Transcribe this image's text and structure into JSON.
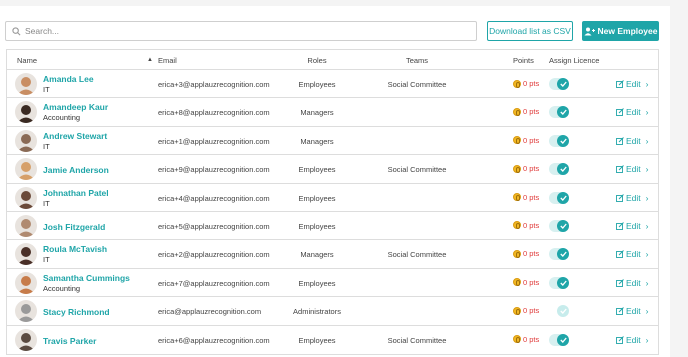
{
  "search": {
    "placeholder": "Search..."
  },
  "toolbar": {
    "download_label": "Download list as CSV",
    "new_employee_label": "New Employee"
  },
  "table": {
    "headers": {
      "name": "Name",
      "email": "Email",
      "roles": "Roles",
      "teams": "Teams",
      "points": "Points",
      "assign_licence": "Assign Licence"
    },
    "edit_label": "Edit",
    "rows": [
      {
        "name": "Amanda Lee",
        "dept": "IT",
        "email": "erica+3@applauzrecognition.com",
        "role": "Employees",
        "team": "Social Committee",
        "points": "0 pts",
        "licence": true
      },
      {
        "name": "Amandeep Kaur",
        "dept": "Accounting",
        "email": "erica+8@applauzrecognition.com",
        "role": "Managers",
        "team": "",
        "points": "0 pts",
        "licence": true
      },
      {
        "name": "Andrew Stewart",
        "dept": "IT",
        "email": "erica+1@applauzrecognition.com",
        "role": "Managers",
        "team": "",
        "points": "0 pts",
        "licence": true
      },
      {
        "name": "Jamie Anderson",
        "dept": "",
        "email": "erica+9@applauzrecognition.com",
        "role": "Employees",
        "team": "Social Committee",
        "points": "0 pts",
        "licence": true
      },
      {
        "name": "Johnathan Patel",
        "dept": "IT",
        "email": "erica+4@applauzrecognition.com",
        "role": "Employees",
        "team": "",
        "points": "0 pts",
        "licence": true
      },
      {
        "name": "Josh Fitzgerald",
        "dept": "",
        "email": "erica+5@applauzrecognition.com",
        "role": "Employees",
        "team": "",
        "points": "0 pts",
        "licence": true
      },
      {
        "name": "Roula McTavish",
        "dept": "IT",
        "email": "erica+2@applauzrecognition.com",
        "role": "Managers",
        "team": "Social Committee",
        "points": "0 pts",
        "licence": true
      },
      {
        "name": "Samantha Cummings",
        "dept": "Accounting",
        "email": "erica+7@applauzrecognition.com",
        "role": "Employees",
        "team": "",
        "points": "0 pts",
        "licence": true
      },
      {
        "name": "Stacy Richmond",
        "dept": "",
        "email": "erica@applauzrecognition.com",
        "role": "Administrators",
        "team": "",
        "points": "0 pts",
        "licence": false
      },
      {
        "name": "Travis Parker",
        "dept": "",
        "email": "erica+6@applauzrecognition.com",
        "role": "Employees",
        "team": "Social Committee",
        "points": "0 pts",
        "licence": true
      }
    ]
  },
  "colors": {
    "accent": "#1fa5a8",
    "points": "#e03a3a"
  },
  "avatar_colors": [
    "#c98e63",
    "#3a2a22",
    "#8a6a55",
    "#d6a06a",
    "#6b4a3a",
    "#b08a70",
    "#4a3028",
    "#c77c4a",
    "#9a9a9a",
    "#5a4a40"
  ]
}
